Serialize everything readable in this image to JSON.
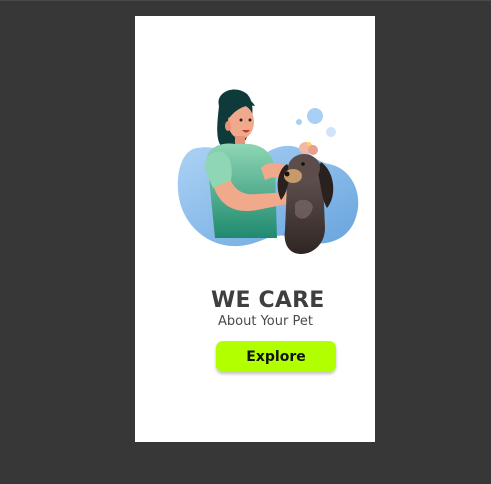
{
  "screen": {
    "title_line": "WE CARE",
    "subtitle_line": "About Your Pet",
    "explore_label": "Explore"
  },
  "colors": {
    "background": "#373737",
    "card": "#ffffff",
    "accent_button": "#b2ff00",
    "title_text": "#3f3f3f",
    "blob_blue": "#7fb6e6",
    "shirt_green": "#2e9c7e"
  },
  "illustration": {
    "icon": "vet-with-dog-illustration"
  }
}
